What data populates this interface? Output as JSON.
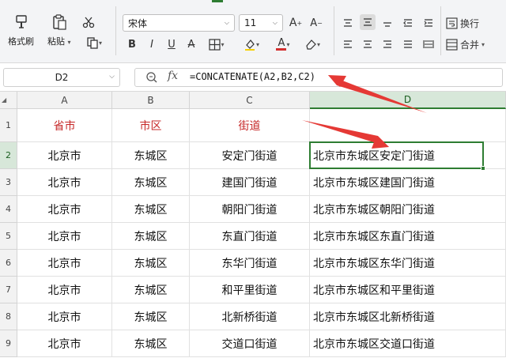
{
  "ribbon": {
    "format_painter": "格式刷",
    "paste": "粘贴",
    "font_name": "宋体",
    "font_size": "11",
    "wrap_text": "换行",
    "merge": "合并",
    "bold": "B",
    "italic": "I",
    "underline": "U",
    "strike": "A",
    "font_color_letter": "A",
    "increase_font": "A",
    "decrease_font": "A"
  },
  "formula_bar": {
    "name_box": "D2",
    "fx_label": "fx",
    "formula": "=CONCATENATE(A2,B2,C2)"
  },
  "columns": [
    "A",
    "B",
    "C",
    "D"
  ],
  "rows": [
    "1",
    "2",
    "3",
    "4",
    "5",
    "6",
    "7",
    "8",
    "9"
  ],
  "table": {
    "header": [
      "省市",
      "市区",
      "街道",
      ""
    ],
    "data": [
      [
        "北京市",
        "东城区",
        "安定门街道",
        "北京市东城区安定门街道"
      ],
      [
        "北京市",
        "东城区",
        "建国门街道",
        "北京市东城区建国门街道"
      ],
      [
        "北京市",
        "东城区",
        "朝阳门街道",
        "北京市东城区朝阳门街道"
      ],
      [
        "北京市",
        "东城区",
        "东直门街道",
        "北京市东城区东直门街道"
      ],
      [
        "北京市",
        "东城区",
        "东华门街道",
        "北京市东城区东华门街道"
      ],
      [
        "北京市",
        "东城区",
        "和平里街道",
        "北京市东城区和平里街道"
      ],
      [
        "北京市",
        "东城区",
        "北新桥街道",
        "北京市东城区北新桥街道"
      ],
      [
        "北京市",
        "东城区",
        "交道口街道",
        "北京市东城区交道口街道"
      ]
    ]
  },
  "colors": {
    "accent_green": "#2e7d32",
    "header_red": "#c62828",
    "annotation_arrow": "#e53935"
  },
  "icons": [
    "format-painter-icon",
    "paste-icon",
    "cut-icon",
    "copy-icon",
    "border-icon",
    "fill-color-icon",
    "font-color-icon",
    "eraser-icon",
    "align-icon",
    "wrap-icon",
    "merge-icon",
    "zoom-icon",
    "chevron-down-icon",
    "annotation-arrow"
  ]
}
